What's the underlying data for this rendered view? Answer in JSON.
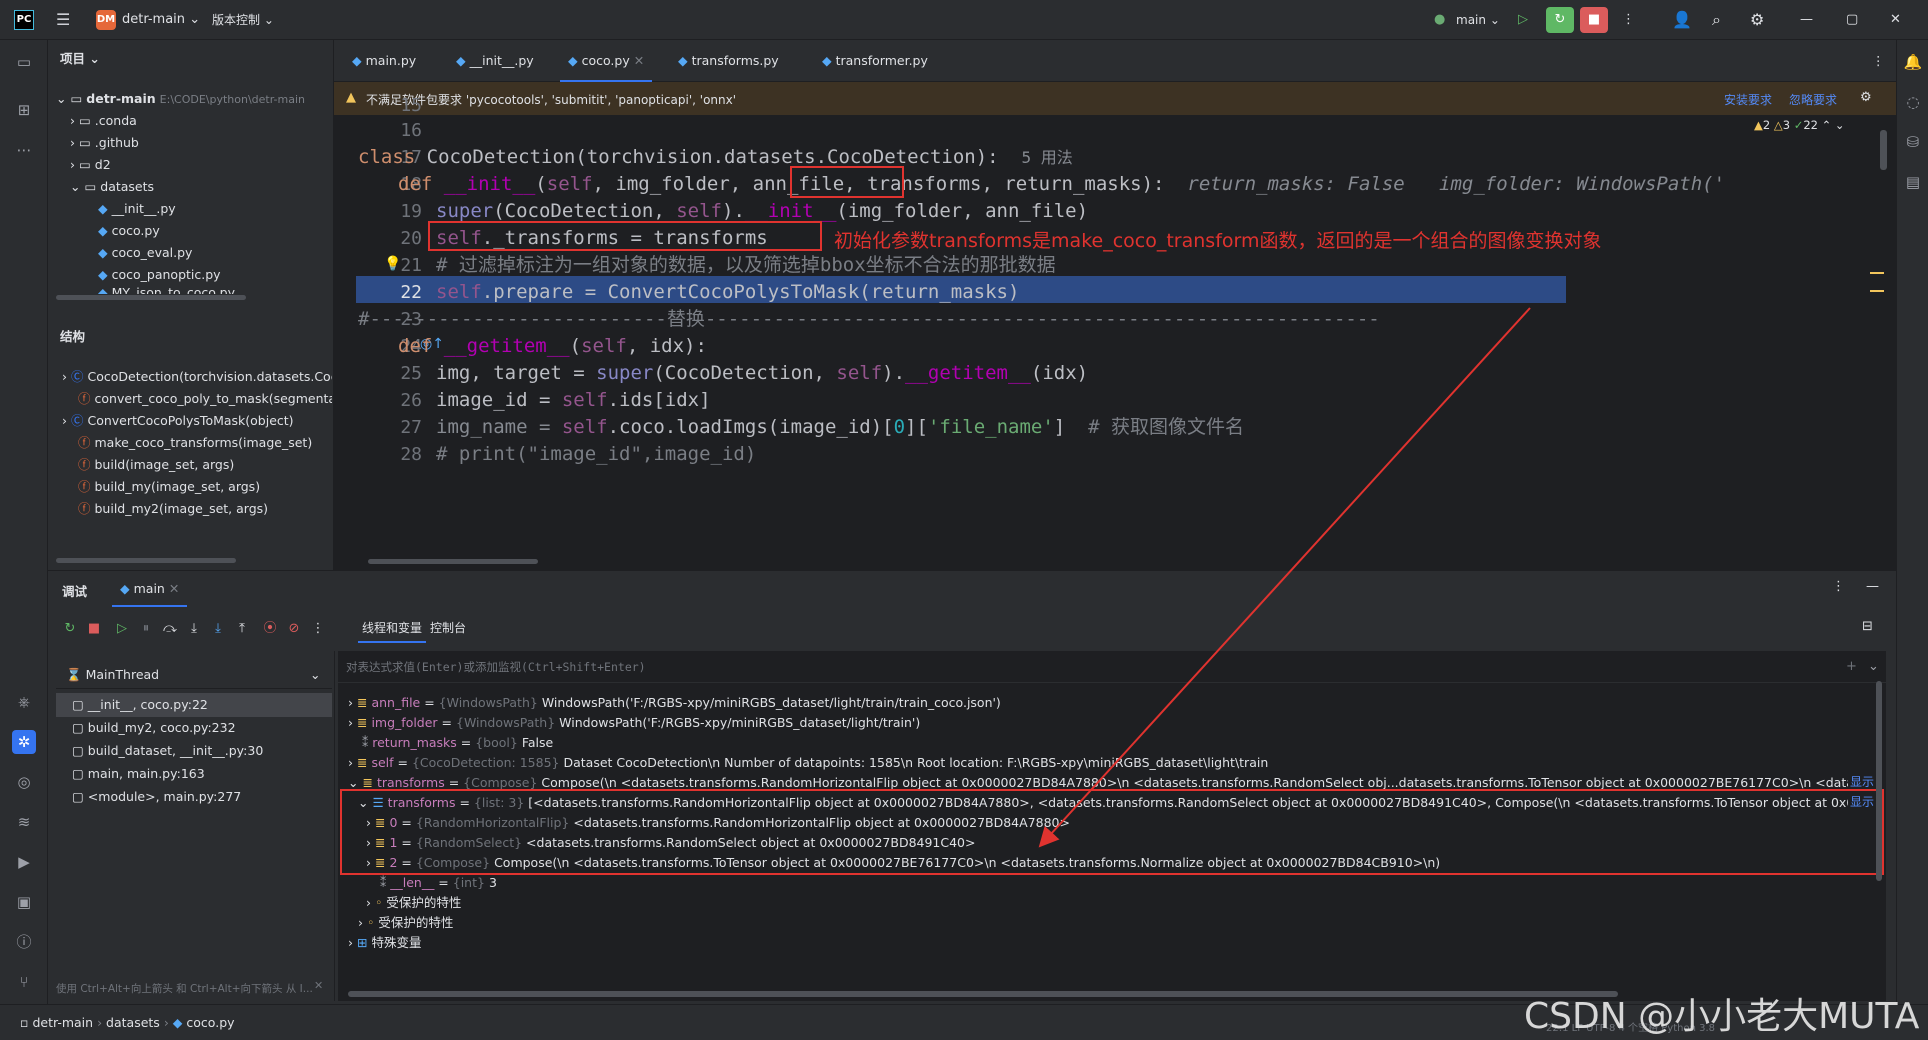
{
  "titlebar": {
    "project_badge": "DM",
    "project_name": "detr-main",
    "vcs_menu": "版本控制",
    "run_config": "main"
  },
  "project_panel": {
    "title": "项目",
    "root_name": "detr-main",
    "root_path": "E:\\CODE\\python\\detr-main",
    "items": [
      ".conda",
      ".github",
      "d2",
      "datasets",
      "__init__.py",
      "coco.py",
      "coco_eval.py",
      "coco_panoptic.py",
      "MY_json_to_coco.py"
    ]
  },
  "structure_panel": {
    "title": "结构",
    "items": [
      "CocoDetection(torchvision.datasets.CocoDetection)",
      "convert_coco_poly_to_mask(segmentations, height, width)",
      "ConvertCocoPolysToMask(object)",
      "make_coco_transforms(image_set)",
      "build(image_set, args)",
      "build_my(image_set, args)",
      "build_my2(image_set, args)"
    ]
  },
  "editor": {
    "tabs": [
      "main.py",
      "__init__.py",
      "coco.py",
      "transforms.py",
      "transformer.py"
    ],
    "active_tab": "coco.py",
    "warning_text": "不满足软件包要求 'pycocotools', 'submitit', 'panopticapi', 'onnx'",
    "warning_install": "安装要求",
    "warning_ignore": "忽略要求",
    "inspections": {
      "warnings": "2",
      "weak": "3",
      "ok": "22"
    },
    "line_numbers": [
      "15",
      "16",
      "17",
      "18",
      "19",
      "20",
      "21",
      "22",
      "23",
      "24",
      "25",
      "26",
      "27",
      "28"
    ],
    "lines": {
      "l17_kw": "class",
      "l17_body": " CocoDetection(torchvision.datasets.CocoDetection):",
      "l17_usage": "5 用法",
      "l18_def": "def",
      "l18_name": "__init__",
      "l18_p1": "(",
      "l18_self": "self",
      "l18_p2": ", img_folder, ann_file, ",
      "l18_transforms": "transforms",
      "l18_p3": ", return_masks):",
      "l18_hint1": "return_masks: False",
      "l18_hint2": "img_folder: WindowsPath('",
      "l19_super": "super",
      "l19_a": "(CocoDetection, ",
      "l19_self": "self",
      "l19_b": ").",
      "l19_init": "__init__",
      "l19_c": "(img_folder, ann_file)",
      "l20_self": "self",
      "l20_rest": "._transforms = transforms",
      "l21_comment": "# 过滤掉标注为一组对象的数据，以及筛选掉bbox坐标不合法的那批数据",
      "l22_self": "self",
      "l22_rest": ".prepare = ConvertCocoPolysToMask(return_masks)",
      "l23_comment": "#--------------------------替换-----------------------------------------------------------",
      "l24_def": "def",
      "l24_name": "__getitem__",
      "l24_a": "(",
      "l24_self": "self",
      "l24_b": ", idx):",
      "l25_a": "img, target = ",
      "l25_super": "super",
      "l25_b": "(CocoDetection, ",
      "l25_self": "self",
      "l25_c": ").",
      "l25_getitem": "__getitem__",
      "l25_d": "(idx)",
      "l26_a": "image_id = ",
      "l26_self": "self",
      "l26_b": ".ids[idx]",
      "l27_a": "img_name = ",
      "l27_self": "self",
      "l27_b": ".coco.loadImgs(image_id)[",
      "l27_num": "0",
      "l27_c": "][",
      "l27_str": "'file_name'",
      "l27_d": "]",
      "l27_comment": "# 获取图像文件名",
      "l28_comment": "# print(\"image_id\",image_id)"
    },
    "annotation": "初始化参数transforms是make_coco_transform函数，返回的是一个组合的图像变换对象"
  },
  "debug": {
    "title": "调试",
    "session_tab": "main",
    "tab_threads": "线程和变量",
    "tab_console": "控制台",
    "thread": "MainThread",
    "eval_placeholder": "对表达式求值(Enter)或添加监视(Ctrl+Shift+Enter)",
    "frames": [
      "__init__, coco.py:22",
      "build_my2, coco.py:232",
      "build_dataset, __init__.py:30",
      "main, main.py:163",
      "<module>, main.py:277"
    ],
    "frames_hint": "使用 Ctrl+Alt+向上箭头 和 Ctrl+Alt+向下箭头 从 I...",
    "variables": [
      {
        "name": "ann_file",
        "type": "{WindowsPath}",
        "value": "WindowsPath('F:/RGBS-xpy/miniRGBS_dataset/light/train/train_coco.json')"
      },
      {
        "name": "img_folder",
        "type": "{WindowsPath}",
        "value": "WindowsPath('F:/RGBS-xpy/miniRGBS_dataset/light/train')"
      },
      {
        "name": "return_masks",
        "type": "{bool}",
        "value": "False"
      },
      {
        "name": "self",
        "type": "{CocoDetection: 1585}",
        "value": "Dataset CocoDetection\\n    Number of datapoints: 1585\\n    Root location: F:\\RGBS-xpy\\miniRGBS_dataset\\light\\train"
      },
      {
        "name": "transforms",
        "type": "{Compose}",
        "value": "Compose(\\n    <datasets.transforms.RandomHorizontalFlip object at 0x0000027BD84A7880>\\n    <datasets.transforms.RandomSelect obj...datasets.transforms.ToTensor object at 0x0000027BE76177C0>\\n    <datasets.transf..."
      },
      {
        "name": "transforms",
        "type": "{list: 3}",
        "value": "[<datasets.transforms.RandomHorizontalFlip object at 0x0000027BD84A7880>, <datasets.transforms.RandomSelect object at 0x0000027BD8491C40>, Compose(\\n    <datasets.transforms.ToTensor object at 0x0000027BE76177..."
      },
      {
        "name": "0",
        "type": "{RandomHorizontalFlip}",
        "value": "<datasets.transforms.RandomHorizontalFlip object at 0x0000027BD84A7880>"
      },
      {
        "name": "1",
        "type": "{RandomSelect}",
        "value": "<datasets.transforms.RandomSelect object at 0x0000027BD8491C40>"
      },
      {
        "name": "2",
        "type": "{Compose}",
        "value": "Compose(\\n    <datasets.transforms.ToTensor object at 0x0000027BE76177C0>\\n    <datasets.transforms.Normalize object at 0x0000027BD84CB910>\\n)"
      },
      {
        "name": "__len__",
        "type": "{int}",
        "value": "3"
      },
      {
        "name": "受保护的特性",
        "type": "",
        "value": ""
      },
      {
        "name": "受保护的特性",
        "type": "",
        "value": ""
      },
      {
        "name": "特殊变量",
        "type": "",
        "value": ""
      }
    ],
    "show_link": "显示"
  },
  "statusbar": {
    "crumbs": [
      "detr-main",
      "datasets",
      "coco.py"
    ],
    "right_items": [
      "22:1",
      "LF",
      "UTF-8",
      "4 个空格",
      "Python 3.8"
    ],
    "watermark": "CSDN @小小老大MUTA"
  },
  "colors": {
    "accent": "#3574f0",
    "annotation_red": "#e0332f",
    "run_green": "#5fb865",
    "stop_red": "#db5c5c"
  }
}
